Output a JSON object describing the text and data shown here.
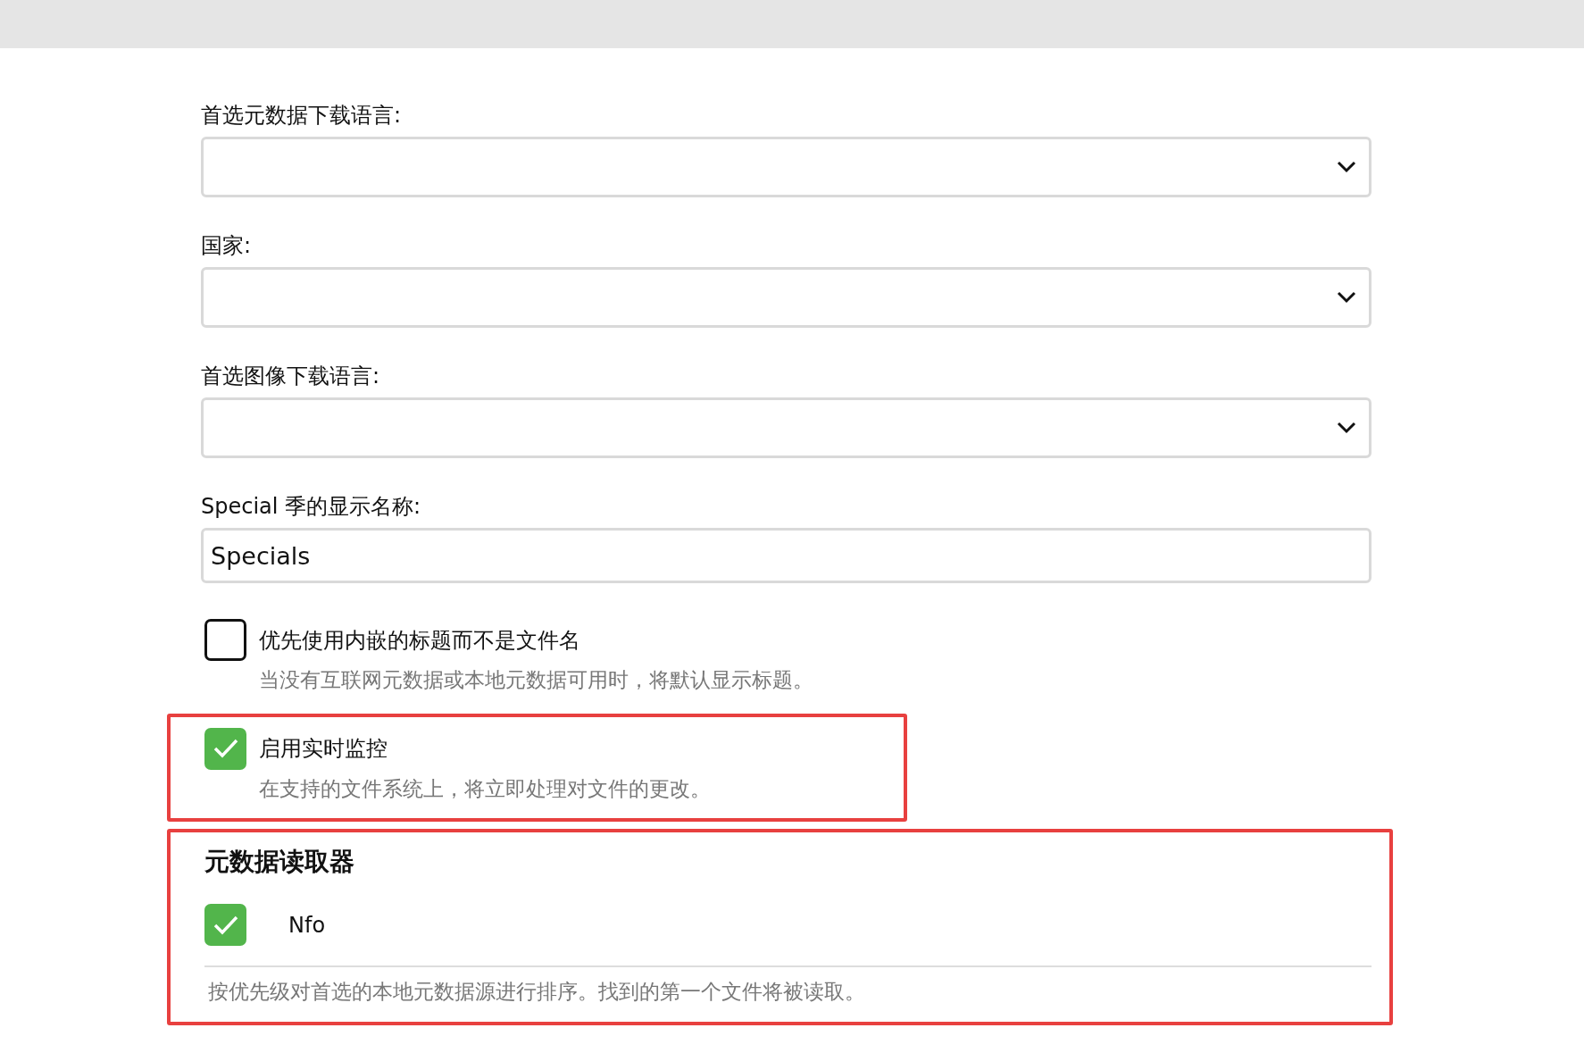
{
  "fields": [
    {
      "kind": "select",
      "label": "首选元数据下载语言:"
    },
    {
      "kind": "select",
      "label": "国家:"
    },
    {
      "kind": "select",
      "label": "首选图像下载语言:"
    },
    {
      "kind": "text",
      "label": "Special 季的显示名称:",
      "value": "Specials"
    }
  ],
  "options": [
    {
      "label": "优先使用内嵌的标题而不是文件名",
      "description": "当没有互联网元数据或本地元数据可用时，将默认显示标题。",
      "checked": false,
      "highlighted": false
    },
    {
      "label": "启用实时监控",
      "description": "在支持的文件系统上，将立即处理对文件的更改。",
      "checked": true,
      "highlighted": true
    }
  ],
  "metadata_readers": {
    "title": "元数据读取器",
    "highlighted": true,
    "items": [
      {
        "label": "Nfo",
        "checked": true
      }
    ],
    "description": "按优先级对首选的本地元数据源进行排序。找到的第一个文件将被读取。"
  }
}
